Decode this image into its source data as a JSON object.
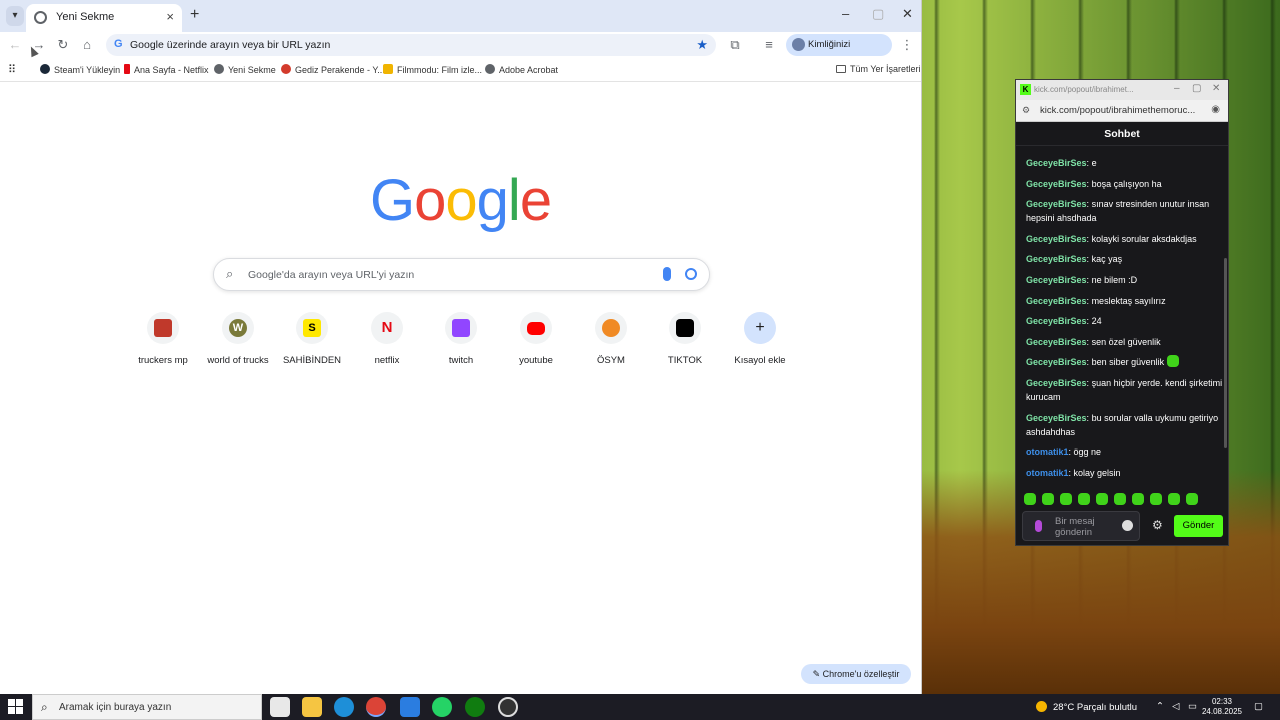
{
  "chrome": {
    "tab_title": "Yeni Sekme",
    "omnibox_placeholder": "Google üzerinde arayın veya bir URL yazın",
    "profile_label": "Kimliğinizi doğrulayın",
    "bookmarks": [
      {
        "label": "Steam'i Yükleyin",
        "color": "#1b2838"
      },
      {
        "label": "Ana Sayfa - Netflix",
        "color": "#e50914"
      },
      {
        "label": "Yeni Sekme",
        "color": "#5f6368"
      },
      {
        "label": "Gediz Perakende - Y...",
        "color": "#d33b2c"
      },
      {
        "label": "Filmmodu: Film izle...",
        "color": "#f0b400"
      },
      {
        "label": "Adobe Acrobat",
        "color": "#5f6368"
      }
    ],
    "all_bookmarks": "Tüm Yer İşaretleri"
  },
  "newtab": {
    "logo_letters": [
      "G",
      "o",
      "o",
      "g",
      "l",
      "e"
    ],
    "logo_colors": [
      "#4285f4",
      "#ea4335",
      "#fbbc05",
      "#4285f4",
      "#34a853",
      "#ea4335"
    ],
    "search_placeholder": "Google'da arayın veya URL'yi yazın",
    "shortcuts": [
      {
        "label": "truckers mp",
        "glyph": "",
        "color": "#c0392b"
      },
      {
        "label": "world of trucks",
        "glyph": "W",
        "color": "#7a7a3a"
      },
      {
        "label": "SAHİBİNDEN",
        "glyph": "S",
        "color": "#ffe800"
      },
      {
        "label": "netflix",
        "glyph": "N",
        "color": "#e50914"
      },
      {
        "label": "twitch",
        "glyph": "",
        "color": "#9146ff"
      },
      {
        "label": "youtube",
        "glyph": "",
        "color": "#ff0000"
      },
      {
        "label": "ÖSYM",
        "glyph": "",
        "color": "#f08a24"
      },
      {
        "label": "TIKTOK",
        "glyph": "",
        "color": "#000000"
      },
      {
        "label": "Kısayol ekle",
        "glyph": "+",
        "color": "#d3e3fd"
      }
    ],
    "customize_label": "Chrome'u özelleştir"
  },
  "kick": {
    "window_title": "kick.com/popout/ibrahimet...",
    "url": "kick.com/popout/ibrahimethemoruc...",
    "header": "Sohbet",
    "messages": [
      {
        "user": "GeceyeBirSes",
        "text": "e",
        "color": "#7fe3a7"
      },
      {
        "user": "GeceyeBirSes",
        "text": "boşa çalışıyon ha",
        "color": "#7fe3a7"
      },
      {
        "user": "GeceyeBirSes",
        "text": "sınav stresinden unutur insan hepsini ahsdhada",
        "color": "#7fe3a7"
      },
      {
        "user": "GeceyeBirSes",
        "text": "kolayki sorular aksdakdjas",
        "color": "#7fe3a7"
      },
      {
        "user": "GeceyeBirSes",
        "text": "kaç yaş",
        "color": "#7fe3a7"
      },
      {
        "user": "GeceyeBirSes",
        "text": "ne bilem :D",
        "color": "#7fe3a7"
      },
      {
        "user": "GeceyeBirSes",
        "text": "meslektaş sayılırız",
        "color": "#7fe3a7"
      },
      {
        "user": "GeceyeBirSes",
        "text": "24",
        "color": "#7fe3a7"
      },
      {
        "user": "GeceyeBirSes",
        "text": "sen özel güvenlik",
        "color": "#7fe3a7"
      },
      {
        "user": "GeceyeBirSes",
        "text": "ben siber güvenlik",
        "color": "#7fe3a7"
      },
      {
        "user": "GeceyeBirSes",
        "text": "şuan hiçbir yerde. kendi şirketimi kurucam",
        "color": "#7fe3a7"
      },
      {
        "user": "GeceyeBirSes",
        "text": "bu sorular valla uykumu getiriyo ashdahdhas",
        "color": "#7fe3a7"
      },
      {
        "user": "otomatik1",
        "text": "ögg ne",
        "color": "#3d8ee8"
      },
      {
        "user": "otomatik1",
        "text": "kolay gelsin",
        "color": "#3d8ee8"
      }
    ],
    "input_placeholder": "Bir mesaj gönderin",
    "send_label": "Gönder"
  },
  "taskbar": {
    "search_placeholder": "Aramak için buraya yazın",
    "weather": "28°C  Parçalı bulutlu",
    "time": "02:33",
    "date": "24.08.2025"
  }
}
